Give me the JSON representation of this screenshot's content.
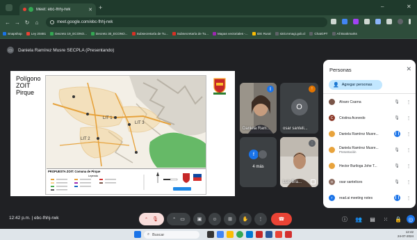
{
  "browser": {
    "tab_title": "Meet: ebc-fhhj-rwk",
    "tab_close": "✕",
    "new_tab": "+",
    "url": "meet.google.com/ebc-fhhj-rwk",
    "window_minimize": "–",
    "window_close": "✕",
    "bookmarks": [
      {
        "label": "Snapshop",
        "color": "#1a73e8"
      },
      {
        "label": "Ley 20481",
        "color": "#ea4335"
      },
      {
        "label": "Decreto 19_ECONO...",
        "color": "#34a853"
      },
      {
        "label": "Decreto 30_ECONO...",
        "color": "#34a853"
      },
      {
        "label": "Subsecretaría de Tu...",
        "color": "#d93025"
      },
      {
        "label": "Subsecretaría de Tu...",
        "color": "#d93025"
      },
      {
        "label": "Mapas vectoriales -...",
        "color": "#9c27b0"
      },
      {
        "label": "IDE Rural",
        "color": "#fbbc04"
      },
      {
        "label": "sinit.mmagi.gob.cl",
        "color": "#5f6368"
      },
      {
        "label": "ChatGPT",
        "color": "#5f6368"
      },
      {
        "label": "All Bookmarks",
        "color": "#5f6368"
      }
    ]
  },
  "meet": {
    "presenting_text": "Daniela Ramírez Musre SECPLA (Presentando)",
    "meeting_time": "12:42 p.m.",
    "meeting_separator": "|",
    "meeting_code": "ebc-fhhj-rwk"
  },
  "slide": {
    "title_line1": "Polígono",
    "title_line2": "ZOIT",
    "title_line3": "Pirque",
    "logo_text": "Pirque",
    "map_title": "PROPUESTA ZOIT: Comuna de Pirque",
    "legend_title": "Leyenda",
    "zone_labels": [
      "LIT 1",
      "LIT 2",
      "LIT 3"
    ]
  },
  "tiles": [
    {
      "name": "Daniela Ram...",
      "kind": "video"
    },
    {
      "name": "osar santeli...",
      "initial": "O",
      "avatar_color": "#5f6368"
    },
    {
      "name": "4 más",
      "initial": "f",
      "avatar_color": "#1a73e8"
    },
    {
      "name": "Luis Bra...",
      "kind": "video"
    }
  ],
  "people_panel": {
    "title": "Personas",
    "close": "✕",
    "add_button": "Agregar personas",
    "participants": [
      {
        "name": "Alvaro Csarna",
        "sub": "",
        "avatar_color": "#795548",
        "initial": "",
        "mic_on": false
      },
      {
        "name": "Cristina Acevedo",
        "sub": "",
        "avatar_color": "#8d3a2a",
        "initial": "C",
        "mic_on": false
      },
      {
        "name": "Daniela Ramírez Musre...",
        "sub": "",
        "avatar_color": "#e8a33c",
        "initial": "",
        "mic_on": true
      },
      {
        "name": "Daniela Ramírez Musre...",
        "sub": "Presentación",
        "avatar_color": "#e8a33c",
        "initial": "",
        "mic_on": false
      },
      {
        "name": "Hector Buriloga Johe T...",
        "sub": "",
        "avatar_color": "#e8a33c",
        "initial": "",
        "mic_on": false
      },
      {
        "name": "osar santelices",
        "sub": "",
        "avatar_color": "#8d6e63",
        "initial": "o",
        "mic_on": false
      },
      {
        "name": "read.ai meeting notes",
        "sub": "",
        "avatar_color": "#1a73e8",
        "initial": "r",
        "mic_on": true
      }
    ]
  },
  "taskbar": {
    "search_placeholder": "Buscar",
    "tray_time": "12:42",
    "tray_date": "24-07-2024"
  },
  "colors": {
    "browser_frame": "#2e4d3b",
    "meet_bg": "#202124",
    "leave_red": "#ea4335",
    "add_people_blue": "#c2e7ff"
  }
}
